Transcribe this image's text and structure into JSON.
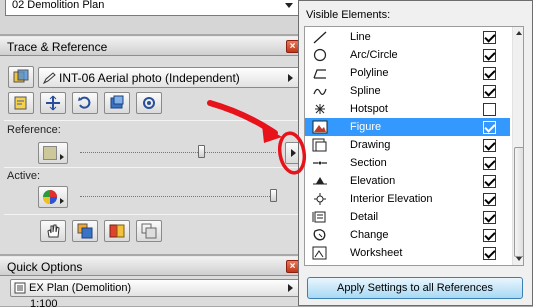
{
  "top": {
    "plan_select_value": "02 Demolition Plan"
  },
  "trace_panel": {
    "title": "Trace & Reference",
    "reference_select_value": "INT-06 Aerial photo (Independent)",
    "reference_label": "Reference:",
    "active_label": "Active:"
  },
  "quick_options": {
    "title": "Quick Options",
    "view_select_value": "EX Plan (Demolition)",
    "scale_value": "1:100"
  },
  "popup": {
    "title": "Visible Elements:",
    "items": [
      {
        "label": "Line",
        "checked": true,
        "icon": "line-icon"
      },
      {
        "label": "Arc/Circle",
        "checked": true,
        "icon": "circle-icon"
      },
      {
        "label": "Polyline",
        "checked": true,
        "icon": "polyline-icon"
      },
      {
        "label": "Spline",
        "checked": true,
        "icon": "spline-icon"
      },
      {
        "label": "Hotspot",
        "checked": false,
        "icon": "hotspot-icon"
      },
      {
        "label": "Figure",
        "checked": true,
        "icon": "figure-icon",
        "selected": true
      },
      {
        "label": "Drawing",
        "checked": true,
        "icon": "drawing-icon"
      },
      {
        "label": "Section",
        "checked": true,
        "icon": "section-icon"
      },
      {
        "label": "Elevation",
        "checked": true,
        "icon": "elevation-icon"
      },
      {
        "label": "Interior Elevation",
        "checked": true,
        "icon": "interior-elevation-icon"
      },
      {
        "label": "Detail",
        "checked": true,
        "icon": "detail-icon"
      },
      {
        "label": "Change",
        "checked": true,
        "icon": "change-icon"
      },
      {
        "label": "Worksheet",
        "checked": true,
        "icon": "worksheet-icon"
      }
    ],
    "apply_label": "Apply Settings to all References"
  },
  "colors": {
    "selection": "#3399ff",
    "annotation": "#e8121a"
  }
}
